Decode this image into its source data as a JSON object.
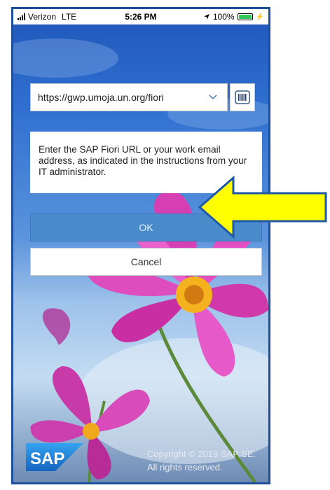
{
  "status_bar": {
    "carrier": "Verizon",
    "network": "LTE",
    "time": "5:26 PM",
    "battery": "100%"
  },
  "login": {
    "url_value": "https://gwp.umoja.un.org/fiori",
    "instructions": "Enter the SAP Fiori URL or your work email address, as indicated in the instructions from your IT administrator.",
    "ok_label": "OK",
    "cancel_label": "Cancel"
  },
  "footer": {
    "logo_text": "SAP",
    "copyright_line1": "Copyright © 2019 SAP SE.",
    "copyright_line2": "All rights reserved."
  },
  "icons": {
    "dropdown": "chevron-down-icon",
    "scanner": "barcode-icon",
    "location": "location-arrow-icon"
  },
  "colors": {
    "ok_button": "#4a8bcb",
    "sap_logo": "#1a78d3",
    "arrow_fill": "#ffff00",
    "arrow_stroke": "#1e5aa8",
    "frame": "#1e4f9c"
  }
}
